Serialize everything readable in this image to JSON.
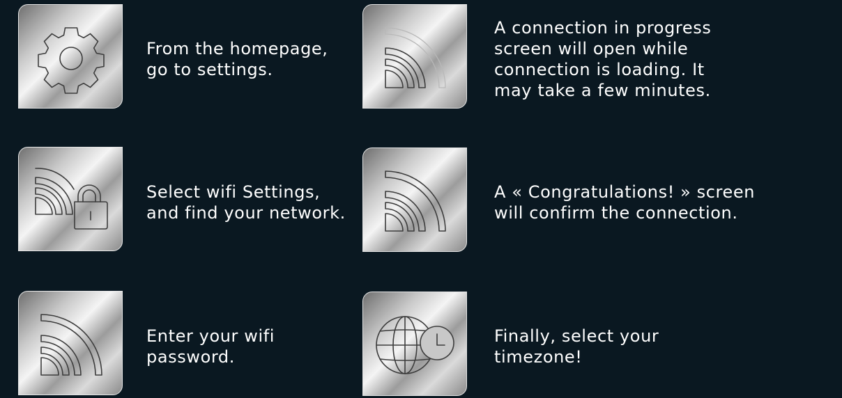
{
  "steps": [
    {
      "icon": "gear-icon",
      "lines": [
        "From the homepage,",
        "go to settings."
      ]
    },
    {
      "icon": "wifi-lock-icon",
      "lines": [
        "Select wifi Settings,",
        "and find your network."
      ]
    },
    {
      "icon": "wifi-icon",
      "lines": [
        "Enter your wifi",
        "password."
      ]
    },
    {
      "icon": "wifi-loading-icon",
      "lines": [
        "A connection in progress",
        "screen will open while",
        "connection is loading. It",
        "may take a few minutes."
      ]
    },
    {
      "icon": "wifi-icon",
      "lines": [
        "A « Congratulations! » screen",
        "will confirm the connection."
      ]
    },
    {
      "icon": "globe-clock-icon",
      "lines": [
        "Finally, select your",
        "timezone!"
      ]
    }
  ]
}
